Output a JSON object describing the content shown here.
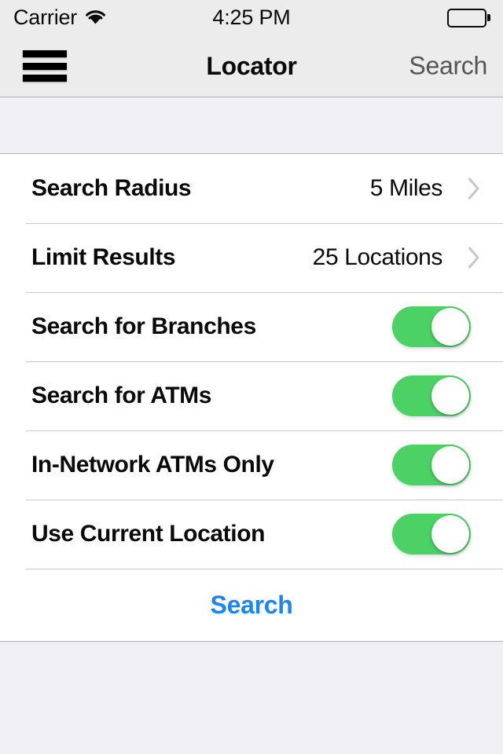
{
  "status_bar": {
    "carrier": "Carrier",
    "wifi_icon": "wifi-icon",
    "time": "4:25 PM",
    "battery_icon": "battery-full-icon"
  },
  "nav_bar": {
    "menu_icon": "hamburger-menu-icon",
    "title": "Locator",
    "action_label": "Search"
  },
  "settings": {
    "rows": [
      {
        "label": "Search Radius",
        "value": "5 Miles",
        "type": "disclosure",
        "accessory_icon": "chevron-right-icon"
      },
      {
        "label": "Limit Results",
        "value": "25 Locations",
        "type": "disclosure",
        "accessory_icon": "chevron-right-icon"
      },
      {
        "label": "Search for Branches",
        "type": "toggle",
        "toggle_on": true
      },
      {
        "label": "Search for ATMs",
        "type": "toggle",
        "toggle_on": true
      },
      {
        "label": "In-Network ATMs Only",
        "type": "toggle",
        "toggle_on": true
      },
      {
        "label": "Use Current Location",
        "type": "toggle",
        "toggle_on": true
      }
    ],
    "submit_label": "Search"
  },
  "colors": {
    "toggle_on": "#4CD264",
    "accent_blue": "#1A85F5",
    "chevron_gray": "#C7C7CC",
    "nav_background": "#ECECEC",
    "page_background": "#EFEFF4",
    "nav_action_gray": "#555557"
  }
}
